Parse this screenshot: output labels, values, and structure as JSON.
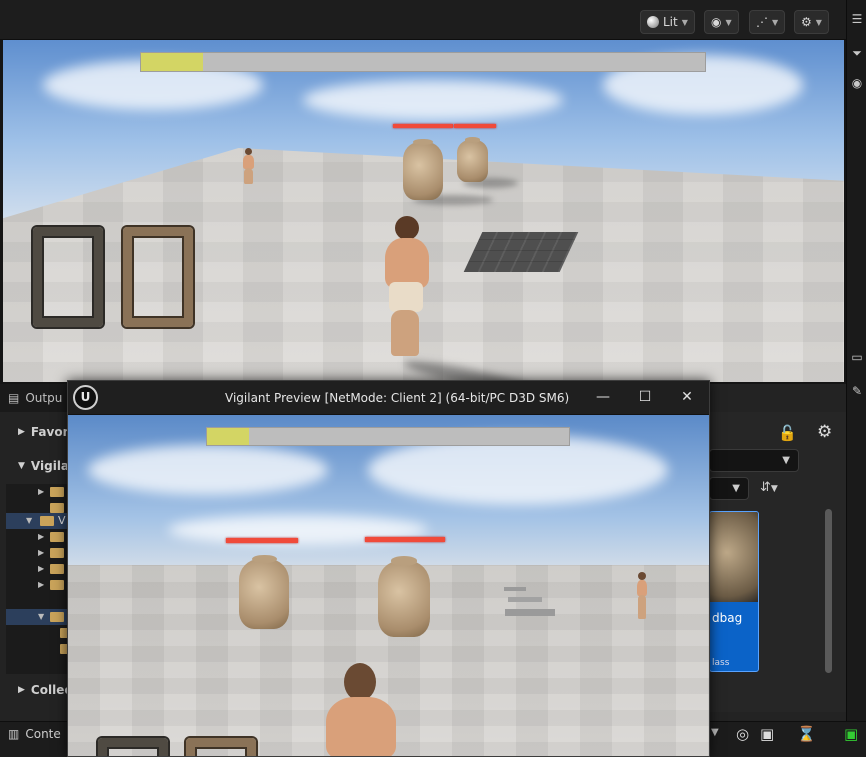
{
  "viewport": {
    "toolbar": {
      "view_mode_label": "Lit",
      "show_icon": "eye-icon",
      "realtime_icon": "sparkle-icon",
      "settings_icon": "gear-icon"
    },
    "hud": {
      "progress_fraction": 0.11,
      "progress_fill_color": "#d3d564",
      "health_bar_color": "#f04a3a"
    }
  },
  "dock": {
    "output_tab_label": "Outpu",
    "content_browser": {
      "favorites_label": "Favor",
      "project_label": "Vigila",
      "collections_label": "Collec",
      "tree_folder_label": "V"
    },
    "asset": {
      "name": "dbag",
      "class_label": "lass"
    },
    "status_bar": {
      "content_drawer_label": "Conte"
    }
  },
  "pie_window": {
    "title": "Vigilant Preview [NetMode: Client 2]  (64-bit/PC D3D SM6)",
    "logo_text": "U",
    "minimize_glyph": "—",
    "maximize_glyph": "☐",
    "close_glyph": "✕",
    "hud": {
      "progress_fraction": 0.115
    }
  }
}
